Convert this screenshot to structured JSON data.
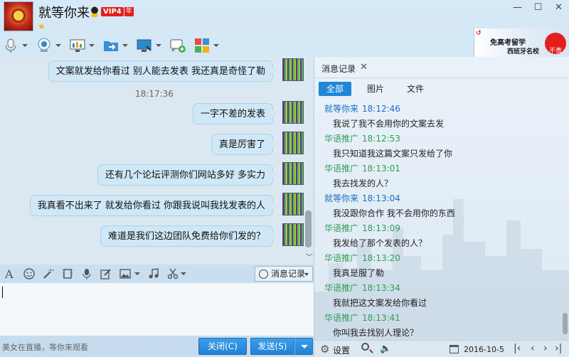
{
  "header": {
    "name": "就等你来",
    "vip_label": "VIP4",
    "vip_year": "年",
    "window_controls": [
      "minimize",
      "maximize",
      "close"
    ]
  },
  "toolbar": {
    "icons": [
      "microphone-icon",
      "webcam-icon",
      "screen-share-icon",
      "file-transfer-icon",
      "remote-desktop-icon",
      "group-chat-icon",
      "apps-icon"
    ]
  },
  "ad": {
    "line1": "免高考留学",
    "line2": "西班牙名校",
    "badge": "不贵"
  },
  "chat": {
    "messages": [
      {
        "text": "文案就发给你看过  别人能去发表  我还真是奇怪了勒"
      },
      {
        "text": "一字不差的发表"
      },
      {
        "text": "真是厉害了"
      },
      {
        "text": "还有几个论坛评测你们网站多好 多实力"
      },
      {
        "text": "我真看不出来了  就发给你看过   你跟我说叫我找发表的人"
      },
      {
        "text": "难道是我们这边团队免费给你们发的？"
      }
    ],
    "timestamp": "18:17:36"
  },
  "input_toolbar": {
    "icons": [
      "font-icon",
      "emoji-icon",
      "magic-wand-icon",
      "video-clip-icon",
      "voice-icon",
      "edit-icon",
      "image-icon",
      "music-icon",
      "screenshot-icon"
    ],
    "history_button": "消息记录"
  },
  "bottom": {
    "status": "美女在直播，等你来观看",
    "close_button": "关闭(C)",
    "send_button": "发送(S)"
  },
  "history_panel": {
    "tab_title": "消息记录",
    "filters": [
      "全部",
      "图片",
      "文件"
    ],
    "entries": [
      {
        "sender": "就等你来",
        "time": "18:12:46",
        "text": "我说了我不会用你的文案去发",
        "self": true
      },
      {
        "sender": "华语推广",
        "time": "18:12:53",
        "text": "我只知道我这篇文案只发给了你",
        "self": false
      },
      {
        "sender": "华语推广",
        "time": "18:13:01",
        "text": "我去找发的人？",
        "self": false
      },
      {
        "sender": "就等你来",
        "time": "18:13:04",
        "text": "我没跟你合作 我不会用你的东西",
        "self": true
      },
      {
        "sender": "华语推广",
        "time": "18:13:09",
        "text": "我发给了那个发表的人？",
        "self": false
      },
      {
        "sender": "华语推广",
        "time": "18:13:20",
        "text": "我真是服了勒",
        "self": false
      },
      {
        "sender": "华语推广",
        "time": "18:13:34",
        "text": "我就把这文案发给你看过",
        "self": false
      },
      {
        "sender": "华语推广",
        "time": "18:13:41",
        "text": "你叫我去找别人理论？",
        "self": false
      }
    ],
    "settings_label": "设置",
    "date": "2016-10-5"
  },
  "colors": {
    "self_sender": "#1b6ec2",
    "other_sender": "#2f9e54",
    "button_blue": "#1f82d6",
    "bubble": "#cfe7f7"
  }
}
